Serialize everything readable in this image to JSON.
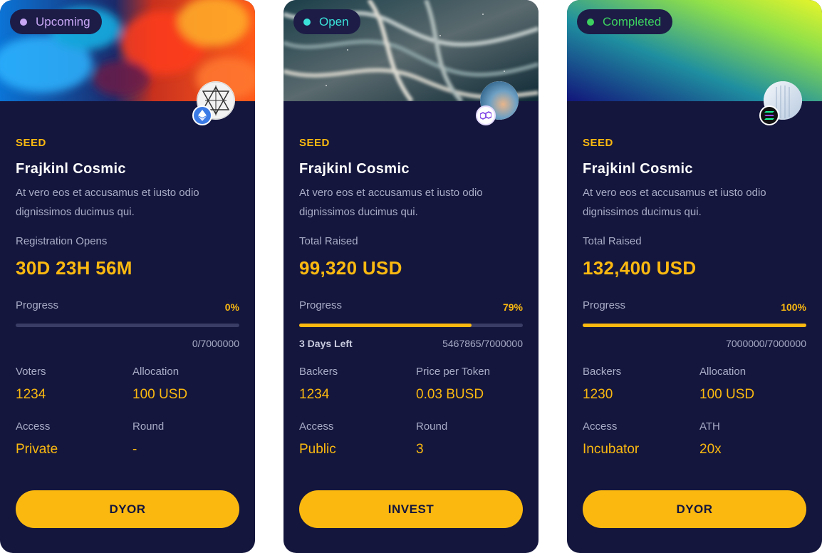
{
  "colors": {
    "card_bg": "#14163d",
    "accent": "#fbb910",
    "text_muted": "#a9acc6",
    "dot_upcoming": "#c9a7f5",
    "dot_open": "#3be1d8",
    "dot_completed": "#3dd15f",
    "status_upcoming": "#c9a7f5",
    "status_open": "#3be1d8",
    "status_completed": "#3dd15f"
  },
  "cards": [
    {
      "status": "Upcoming",
      "chain_icon": "ethereum-icon",
      "stage": "SEED",
      "title": "Frajkinl Cosmic",
      "description": "At vero eos et accusamus et iusto odio dignissimos ducimus qui.",
      "metric_label": "Registration Opens",
      "metric_value": "30D 23H 56M",
      "progress_label": "Progress",
      "progress_pct": "0%",
      "progress_fraction": 0,
      "days_left": "",
      "raised_ratio": "0/7000000",
      "stats": [
        {
          "label": "Voters",
          "value": "1234"
        },
        {
          "label": "Allocation",
          "value": "100 USD"
        },
        {
          "label": "Access",
          "value": "Private"
        },
        {
          "label": "Round",
          "value": "-"
        }
      ],
      "button": "DYOR"
    },
    {
      "status": "Open",
      "chain_icon": "polygon-icon",
      "stage": "SEED",
      "title": "Frajkinl Cosmic",
      "description": "At vero eos et accusamus et iusto odio dignissimos ducimus qui.",
      "metric_label": "Total Raised",
      "metric_value": "99,320 USD",
      "progress_label": "Progress",
      "progress_pct": "79%",
      "progress_fraction": 0.77,
      "days_left": "3 Days Left",
      "raised_ratio": "5467865/7000000",
      "stats": [
        {
          "label": "Backers",
          "value": "1234"
        },
        {
          "label": "Price per Token",
          "value": "0.03 BUSD"
        },
        {
          "label": "Access",
          "value": "Public"
        },
        {
          "label": "Round",
          "value": "3"
        }
      ],
      "button": "INVEST"
    },
    {
      "status": "Completed",
      "chain_icon": "solana-icon",
      "stage": "SEED",
      "title": "Frajkinl Cosmic",
      "description": "At vero eos et accusamus et iusto odio dignissimos ducimus qui.",
      "metric_label": "Total Raised",
      "metric_value": "132,400 USD",
      "progress_label": "Progress",
      "progress_pct": "100%",
      "progress_fraction": 1,
      "days_left": "",
      "raised_ratio": "7000000/7000000",
      "stats": [
        {
          "label": "Backers",
          "value": "1230"
        },
        {
          "label": "Allocation",
          "value": "100 USD"
        },
        {
          "label": "Access",
          "value": "Incubator"
        },
        {
          "label": "ATH",
          "value": "20x"
        }
      ],
      "button": "DYOR"
    }
  ]
}
